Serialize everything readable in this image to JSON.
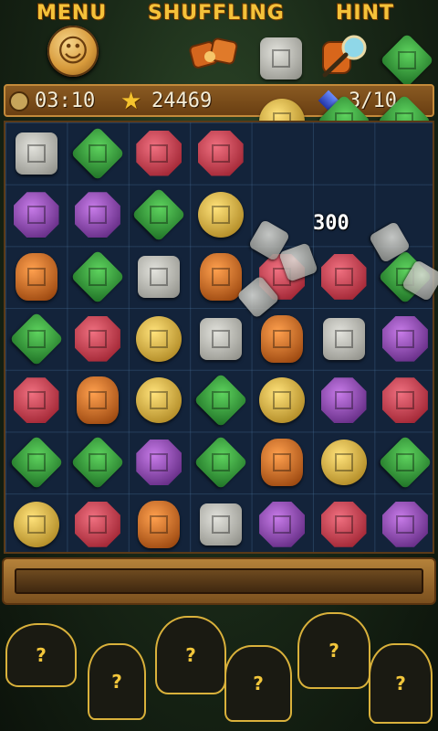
{
  "menu": {
    "menu_label": "MENU",
    "shuffle_label": "SHUFFLING",
    "hint_label": "HINT"
  },
  "status": {
    "timer": "03:10",
    "score": "24469",
    "collected": "3/10"
  },
  "score_popup": "300",
  "progress": {
    "fill_fraction": 0.0
  },
  "colors": {
    "red": "#c8283a",
    "green": "#2f9a3a",
    "purple": "#8d3bb8",
    "gold": "#d6a825",
    "orange": "#d8661b",
    "silver": "#9b9b92",
    "teal": "#3fbfc0"
  },
  "board": {
    "rows": [
      [
        "silver-square",
        "green-diamond",
        "red-oct",
        "red-oct",
        "",
        "",
        ""
      ],
      [
        "purple-oct",
        "purple-oct",
        "green-diamond",
        "gold-circle",
        "",
        "",
        ""
      ],
      [
        "orange-shield",
        "green-diamond",
        "silver-square",
        "orange-shield",
        "red-oct",
        "red-oct",
        "green-diamond"
      ],
      [
        "green-diamond",
        "red-oct",
        "gold-circle",
        "silver-square",
        "orange-shield",
        "silver-square",
        "purple-oct"
      ],
      [
        "red-oct",
        "orange-shield",
        "gold-circle",
        "green-diamond",
        "gold-circle",
        "purple-oct",
        "red-oct"
      ],
      [
        "green-diamond",
        "green-diamond",
        "purple-oct",
        "green-diamond",
        "orange-shield",
        "gold-circle",
        "green-diamond"
      ],
      [
        "gold-circle",
        "red-oct",
        "orange-shield",
        "silver-square",
        "purple-oct",
        "red-oct",
        "purple-oct"
      ]
    ]
  },
  "queue": [
    "gold-circle",
    "green-diamond",
    "green-diamond"
  ],
  "characters": [
    "?",
    "?",
    "?",
    "?",
    "?",
    "?"
  ]
}
